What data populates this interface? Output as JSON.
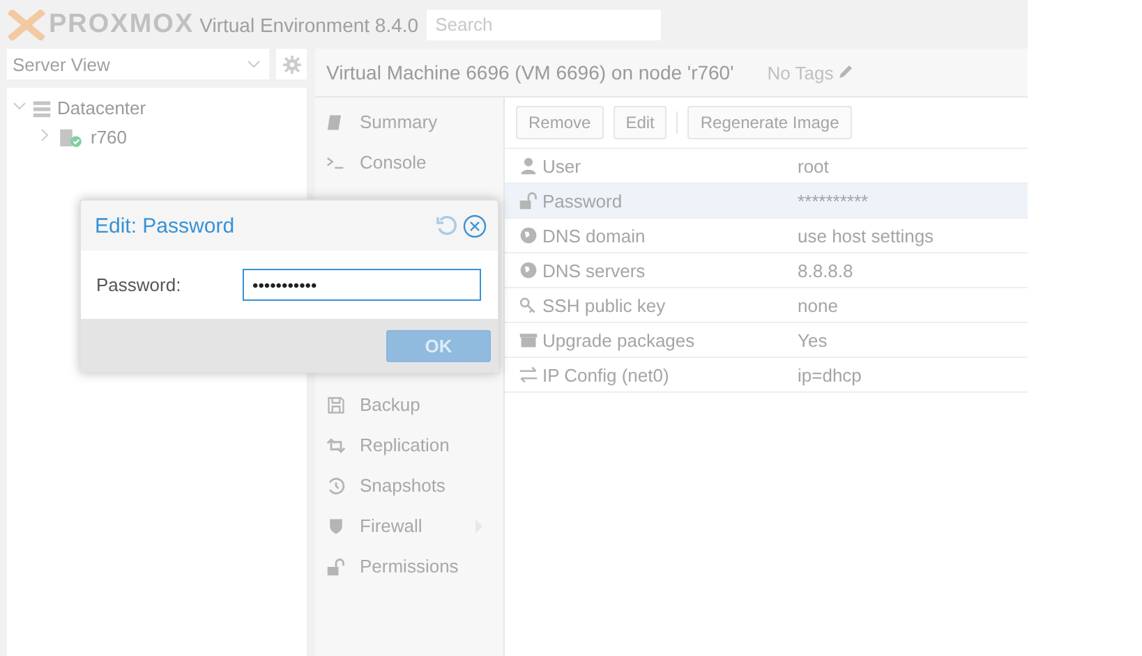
{
  "header": {
    "product": "PROXMOX",
    "version": "Virtual Environment 8.4.0",
    "search": {
      "placeholder": "Search"
    }
  },
  "sidebar": {
    "view": "Server View",
    "tree": [
      {
        "label": "Datacenter",
        "kind": "datacenter",
        "expanded": true,
        "children": [
          {
            "label": "r760",
            "kind": "node",
            "expanded": false
          }
        ]
      }
    ]
  },
  "panel": {
    "title": "Virtual Machine 6696 (VM 6696) on node 'r760'",
    "tags": "No Tags"
  },
  "nav": [
    {
      "label": "Summary",
      "submenu": false
    },
    {
      "label": "Console",
      "submenu": false
    },
    {
      "label": "Backup",
      "submenu": false
    },
    {
      "label": "Replication",
      "submenu": false
    },
    {
      "label": "Snapshots",
      "submenu": false
    },
    {
      "label": "Firewall",
      "submenu": true
    },
    {
      "label": "Permissions",
      "submenu": false
    }
  ],
  "toolbar": [
    "Remove",
    "Edit",
    "Regenerate Image"
  ],
  "rows": [
    {
      "label": "User",
      "value": "root",
      "selected": false
    },
    {
      "label": "Password",
      "value": "**********",
      "selected": true
    },
    {
      "label": "DNS domain",
      "value": "use host settings",
      "selected": false
    },
    {
      "label": "DNS servers",
      "value": "8.8.8.8",
      "selected": false
    },
    {
      "label": "SSH public key",
      "value": "none",
      "selected": false
    },
    {
      "label": "Upgrade packages",
      "value": "Yes",
      "selected": false
    },
    {
      "label": "IP Config (net0)",
      "value": "ip=dhcp",
      "selected": false
    }
  ],
  "dialog": {
    "title": "Edit: Password",
    "field_label": "Password:",
    "value": "•••••••••••",
    "button": {
      "label": "OK",
      "disabled": true
    }
  }
}
